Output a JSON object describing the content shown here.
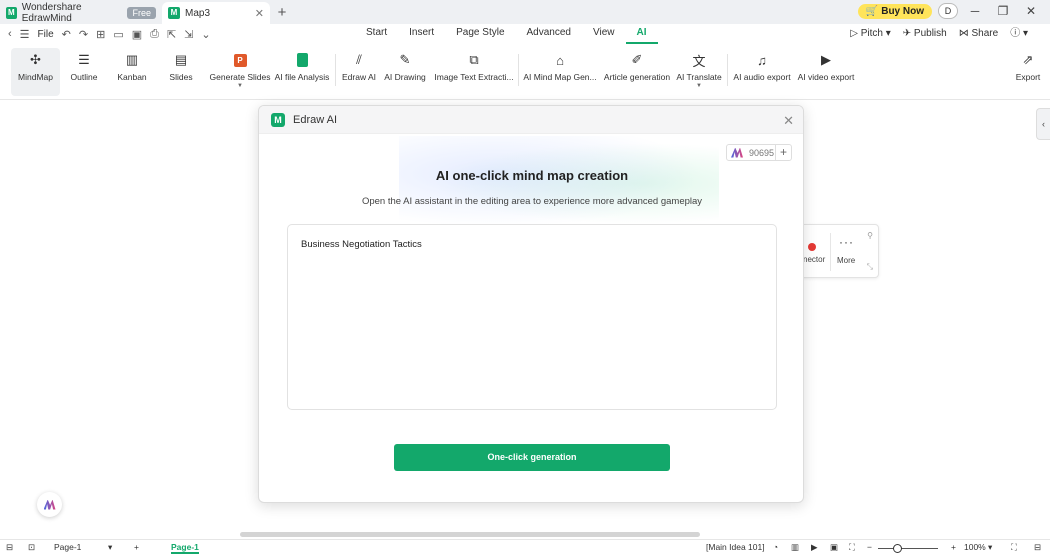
{
  "titlebar": {
    "app_name": "Wondershare EdrawMind",
    "app_badge": "Free",
    "doc_tab": "Map3",
    "buy_now": "Buy Now",
    "avatar_letter": "D"
  },
  "menubar": {
    "file": "File",
    "tabs": [
      "Start",
      "Insert",
      "Page Style",
      "Advanced",
      "View",
      "AI"
    ],
    "active_tab": "AI",
    "right": {
      "pitch": "Pitch",
      "publish": "Publish",
      "share": "Share"
    }
  },
  "ribbon": {
    "views": [
      "MindMap",
      "Outline",
      "Kanban",
      "Slides"
    ],
    "tools": [
      "Generate Slides",
      "AI file Analysis",
      "Edraw AI",
      "AI Drawing",
      "Image Text Extracti...",
      "AI Mind Map Gen...",
      "Article generation",
      "AI Translate",
      "AI audio export",
      "AI video export"
    ],
    "export": "Export"
  },
  "floatbar": {
    "connector": "nector",
    "more": "More"
  },
  "dialog": {
    "title": "Edraw AI",
    "credits": "90695",
    "heading": "AI one-click mind map creation",
    "subtitle": "Open the AI assistant in the editing area to experience more advanced gameplay",
    "prompt_text": "Business Negotiation Tactics",
    "generate_button": "One-click generation"
  },
  "statusbar": {
    "page_select": "Page-1",
    "page_tab": "Page-1",
    "main_idea": "[Main Idea 101]",
    "zoom": "100%"
  },
  "colors": {
    "accent": "#13a86b",
    "buy": "#ffe45a"
  }
}
